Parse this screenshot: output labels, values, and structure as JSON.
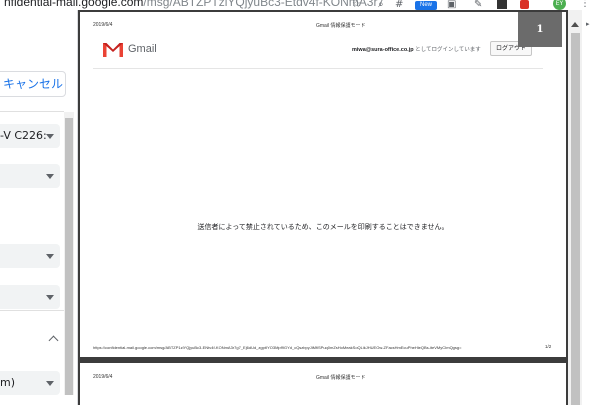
{
  "browser": {
    "url_host": "nfidential-mail.google.com",
    "url_path": "/msg/ABTZPTzlYQjyuBc3-Etdv4f-KONmA3r7",
    "new_badge": "New",
    "profile_initials": "EY"
  },
  "print_panel": {
    "cancel_label": "キャンセル",
    "printer_value": "-V C226:",
    "collapsed_section_value": "m)"
  },
  "preview": {
    "page1": {
      "date": "2019/6/4",
      "header_title": "Gmail 情報保護モード",
      "gmail_wordmark": "Gmail",
      "login_email": "miwa@sura-office.co.jp",
      "login_suffix": " としてログインしています",
      "logout_label": "ログアウト",
      "message": "送信者によって禁止されているため、このメールを印刷することはできません。",
      "footer_url": "https://confidential-mail.google.com/msg/ABTZP1zlYQjyuBc3-ENtv4f-KONmA3r7g7_Ej6dUd_zgptIYO3Mpf9GYd_cQszbpyJiMfiSPuq0mZsHoMeakSoQLikJHUEOw-ZFacsHmEcuPheHieQBs-iteVMyCImQgsg=",
      "page_number": "1/2"
    },
    "page2": {
      "date": "2019/6/4",
      "header_title": "Gmail 情報保護モード"
    },
    "page_badge": "1"
  },
  "colors": {
    "accent": "#1a73e8",
    "gmail_red": "#ea4335",
    "preview_frame": "#3c3c3c"
  }
}
